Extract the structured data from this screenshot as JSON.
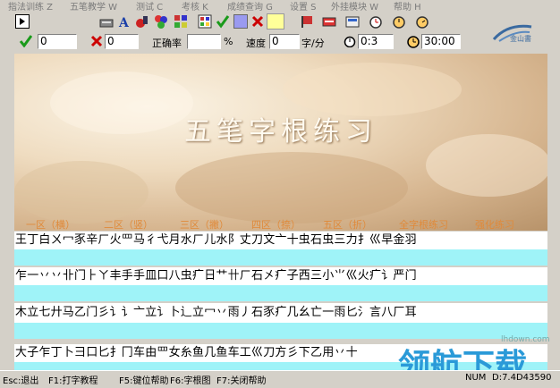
{
  "menu": [
    "指法训练 Z",
    "五笔教学 W",
    "测试 C",
    "考核 K",
    "成绩查询 G",
    "设置 S",
    "外挂模块 W",
    "帮助 H"
  ],
  "toolbar_icons": [
    "play-icon",
    "keyboard-icon",
    "font-icon",
    "tools-icon",
    "palette-icon",
    "grid-icon",
    "check-icon",
    "color-swatch-icon",
    "close-icon",
    "yellow-swatch-icon",
    "flag-icon",
    "keyboard2-icon",
    "tab-icon",
    "alarm-icon",
    "alarm2-icon"
  ],
  "status": {
    "correct_value": "0",
    "wrong_value": "0",
    "accuracy_label": "正确率",
    "accuracy_value": "",
    "percent_label": "%",
    "speed_label": "速度",
    "speed_value": "0",
    "speed_unit": "字/分",
    "elapsed_value": "0:3",
    "limit_value": "30:00"
  },
  "logo_text": "金山書",
  "banner_title": "五笔字根练习",
  "zones": [
    "一区（横）",
    "二区（竖）",
    "三区（撇）",
    "四区（捺）",
    "五区（折）",
    "全字根练习",
    "强化练习"
  ],
  "lines": [
    "王丁白ㄨ冖豕辛ㄏ火罒马彳弋月水ㄏ儿水阝丈刀文亠十虫石虫三力扌巛早金羽",
    "乍一丷丷卝门⺊ㄚ丰手手皿口八虫疒日艹卄ㄏ石㐅疒子西三小⺌巛火疒讠严门",
    "木立七廾马乙门彡讠讠亠立讠卜辶立冖丷雨丿石豕疒几幺亡一雨匕氵言八厂耳",
    "大子乍丁卜彐口匕扌冂车由罒女糸鱼几鱼车工巛刀方彡下乙用丷十"
  ],
  "statusbar": [
    "Esc:退出",
    "F1:打字教程",
    "F5:键位帮助",
    "F6:字根图",
    "F7:关闭帮助",
    "NUM",
    "D:7.4D43590"
  ],
  "watermark": "领航下载",
  "watermark_url": "lhdown.com"
}
